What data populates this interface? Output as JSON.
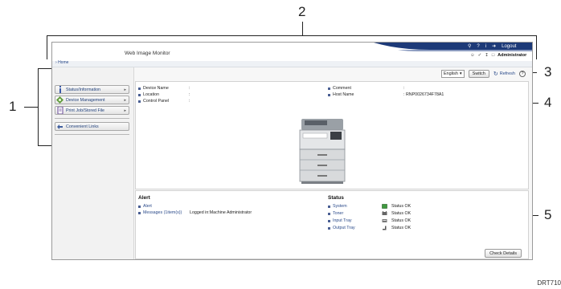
{
  "callouts": {
    "n1": "1",
    "n2": "2",
    "n3": "3",
    "n4": "4",
    "n5": "5"
  },
  "header": {
    "app_title": "Web Image Monitor",
    "logout_label": "Logout",
    "admin_label": "Administrator",
    "brand_color": "#1d3a78"
  },
  "breadcrumb": {
    "home": "Home"
  },
  "sidebar": {
    "items": [
      {
        "label": "Status/Information",
        "icon": "info-icon"
      },
      {
        "label": "Device Management",
        "icon": "device-management-icon"
      },
      {
        "label": "Print Job/Stored File",
        "icon": "document-icon"
      },
      {
        "label": "Convenient Links",
        "icon": "link-icon"
      }
    ]
  },
  "toolbar": {
    "language": "English",
    "switch_label": "Switch",
    "refresh_label": "Refresh"
  },
  "device_info": {
    "device_name_label": "Device Name",
    "device_name_value": "",
    "location_label": "Location",
    "location_value": "",
    "control_panel_label": "Control Panel",
    "control_panel_value": "",
    "comment_label": "Comment",
    "comment_value": "",
    "host_name_label": "Host Name",
    "host_name_value": "RNP0026734F78A1",
    "colon": ":"
  },
  "alert": {
    "title": "Alert",
    "alert_link": "Alert",
    "messages_link": "Messages (1item(s))",
    "logged_in_text": "Logged in:Machine Administrator"
  },
  "status": {
    "title": "Status",
    "rows": [
      {
        "label": "System",
        "value": "Status OK",
        "icon": "system-status-icon"
      },
      {
        "label": "Toner",
        "value": "Status OK",
        "icon": "toner-icon"
      },
      {
        "label": "Input Tray",
        "value": "Status OK",
        "icon": "input-tray-icon"
      },
      {
        "label": "Output Tray",
        "value": "Status OK",
        "icon": "output-tray-icon"
      }
    ],
    "check_details_label": "Check Details"
  },
  "figure_code": "DRT710"
}
